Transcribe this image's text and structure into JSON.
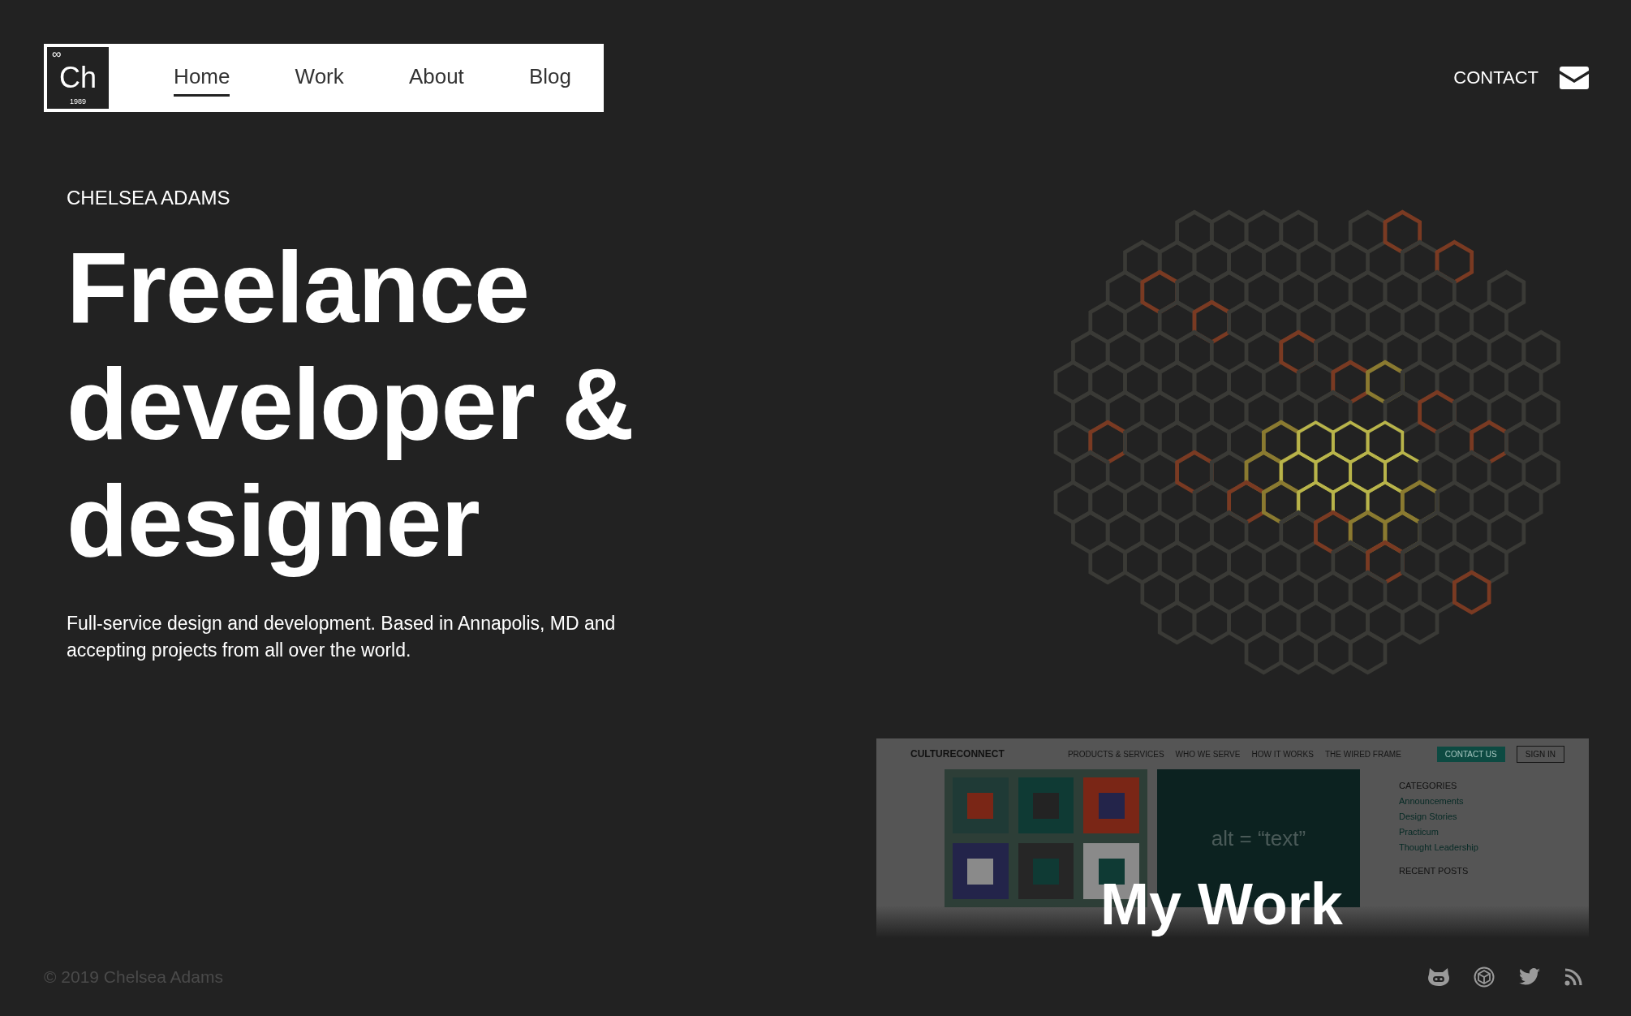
{
  "header": {
    "logo": {
      "symbol": "Ch",
      "mark": "∞",
      "year": "1989"
    },
    "nav": [
      {
        "label": "Home",
        "selected": true
      },
      {
        "label": "Work",
        "selected": false
      },
      {
        "label": "About",
        "selected": false
      },
      {
        "label": "Blog",
        "selected": false
      }
    ],
    "contact": "CONTACT"
  },
  "hero": {
    "eyebrow": "CHELSEA ADAMS",
    "headline": [
      "Freelance",
      "developer &",
      "designer"
    ],
    "intro": "Full-service design and development. Based in Annapolis, MD and accepting projects from all over the world."
  },
  "work_preview": {
    "brand": "CULTURECONNECT",
    "nav": [
      "PRODUCTS & SERVICES",
      "WHO WE SERVE",
      "HOW IT WORKS",
      "THE WIRED FRAME"
    ],
    "buttons": [
      "CONTACT US",
      "SIGN IN"
    ],
    "image_text": "alt = “text”",
    "categories_title": "CATEGORIES",
    "categories": [
      "Announcements",
      "Design Stories",
      "Practicum",
      "Thought Leadership"
    ],
    "recent_title": "RECENT POSTS",
    "heading": "My Work"
  },
  "footer": {
    "copyright": "© 2019 Chelsea Adams"
  }
}
